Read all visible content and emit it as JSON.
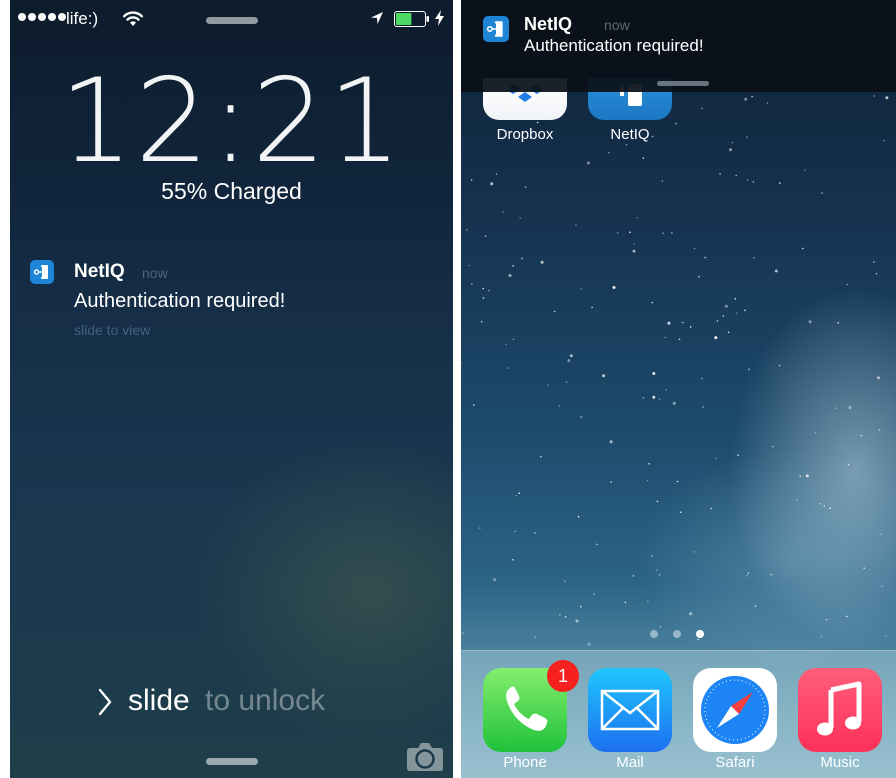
{
  "lock_screen": {
    "status_bar": {
      "carrier": "life:)",
      "signal_bars": 5
    },
    "clock": "12:21",
    "charge_status": "55% Charged",
    "battery_level_percent": 55,
    "notification": {
      "app_name": "NetIQ",
      "time": "now",
      "message": "Authentication required!",
      "hint": "slide to view"
    },
    "unlock": {
      "word_bright": "slide",
      "word_dim": "to unlock"
    }
  },
  "home_screen": {
    "banner": {
      "app_name": "NetIQ",
      "time": "now",
      "message": "Authentication required!"
    },
    "apps": [
      {
        "label": "Dropbox",
        "icon": "dropbox-icon"
      },
      {
        "label": "NetIQ",
        "icon": "netiq-icon"
      }
    ],
    "page_count": 3,
    "current_page": 3,
    "dock": [
      {
        "label": "Phone",
        "icon": "phone-icon",
        "badge": "1",
        "color": "#1fc23b"
      },
      {
        "label": "Mail",
        "icon": "mail-icon",
        "color": "#1c6ff0"
      },
      {
        "label": "Safari",
        "icon": "compass-icon",
        "color": "#1d84f5"
      },
      {
        "label": "Music",
        "icon": "music-note-icon",
        "color": "#fc3159"
      }
    ]
  },
  "colors": {
    "app_badge_blue": "#1f86d6",
    "notification_badge_red": "#f5201f"
  }
}
